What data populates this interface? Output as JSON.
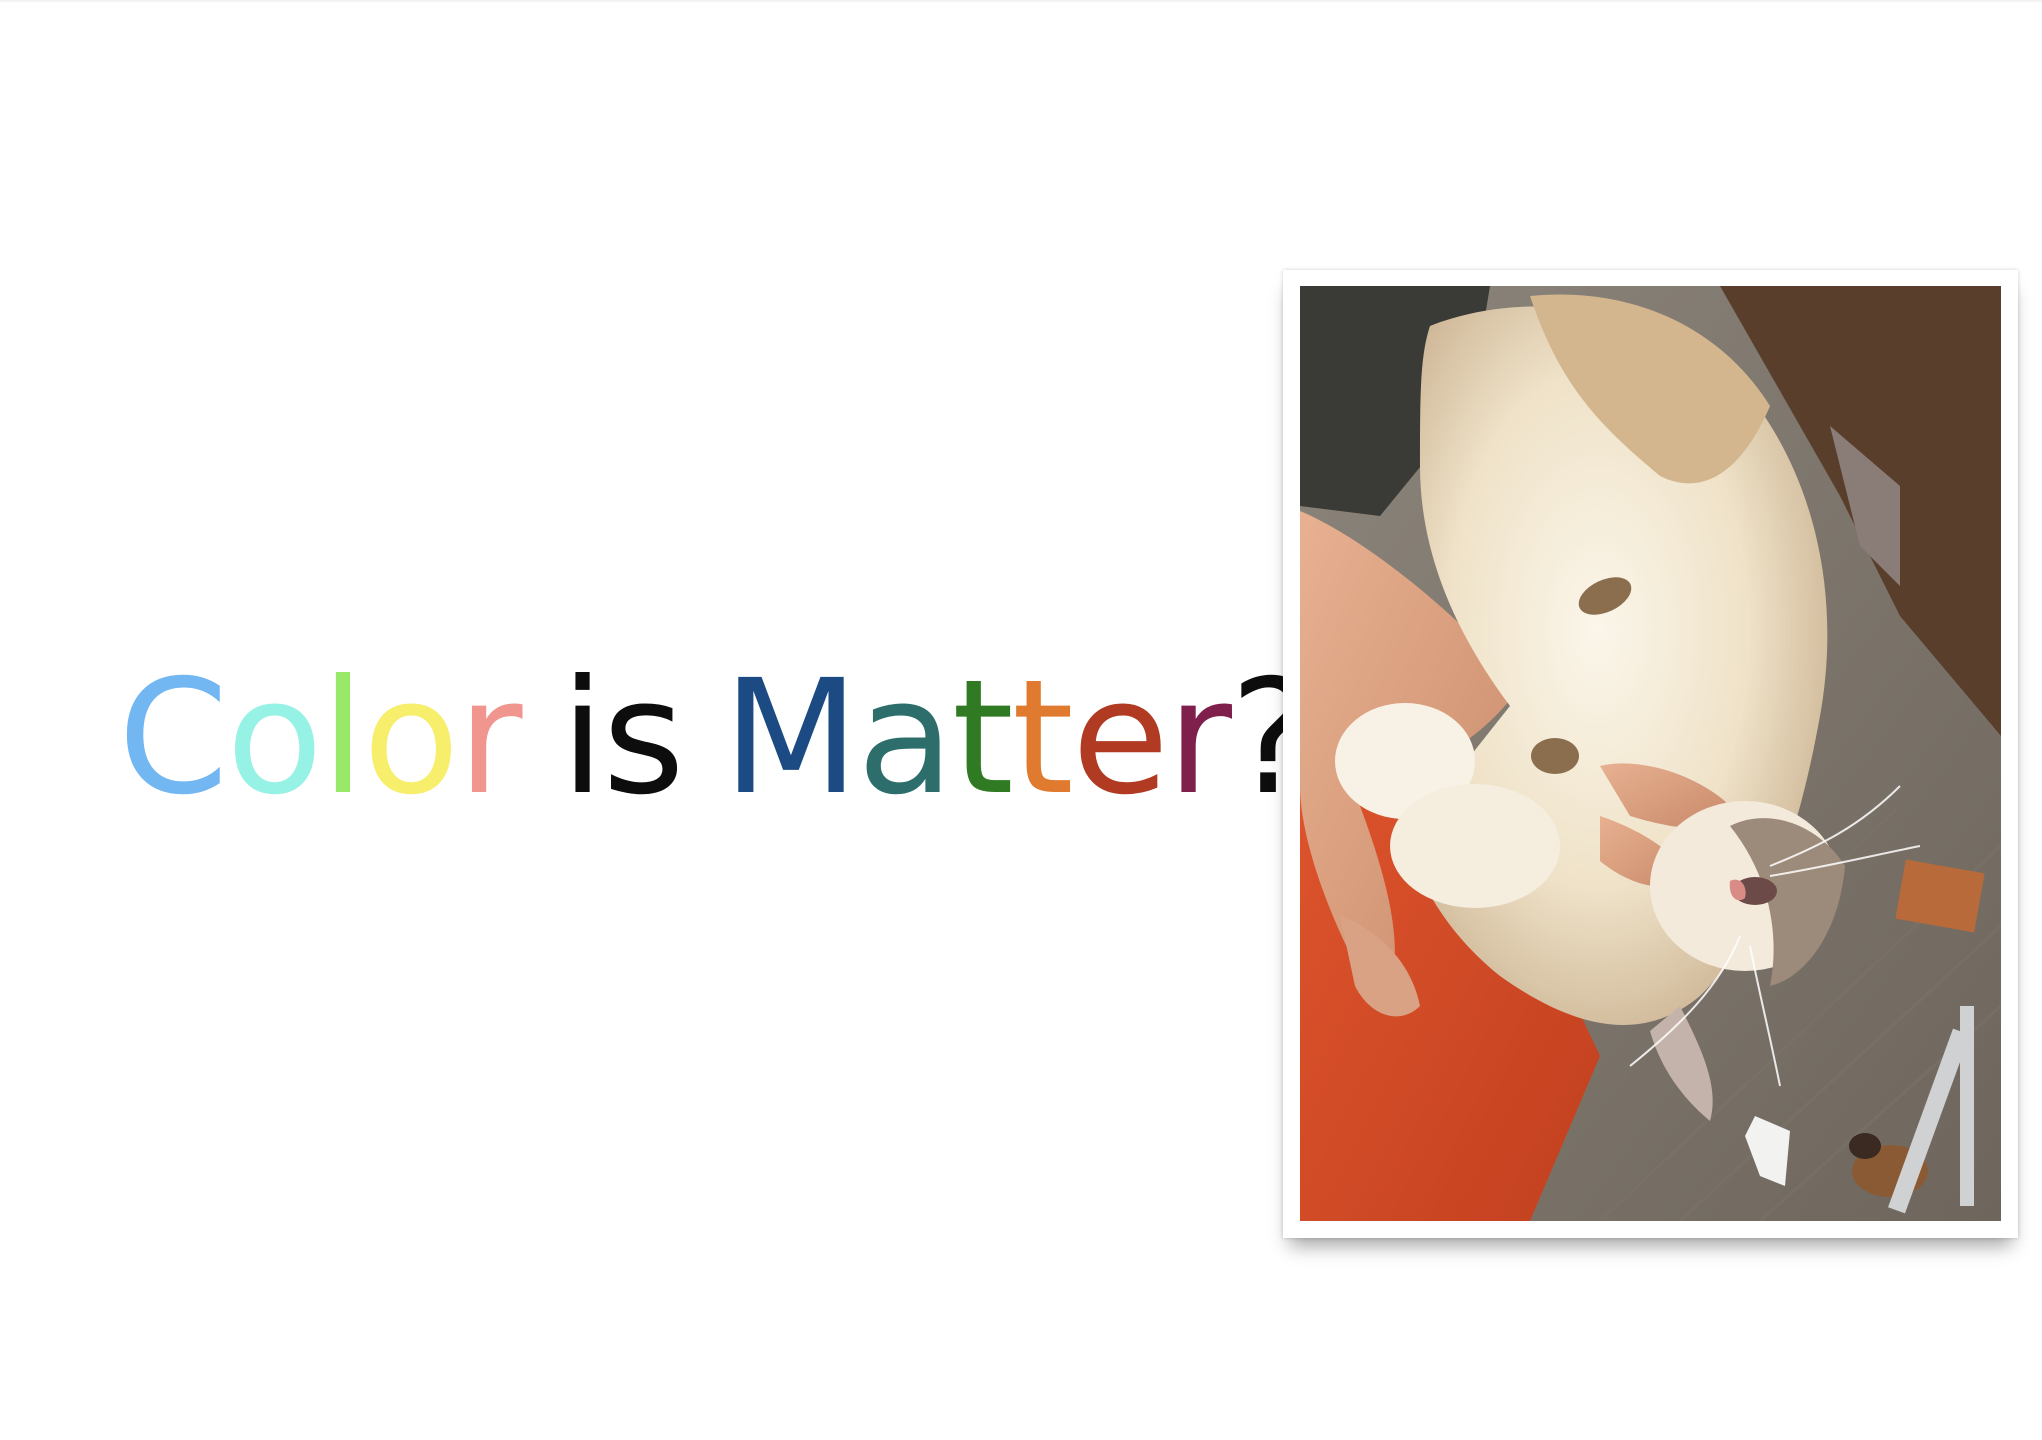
{
  "slide": {
    "title_letters": [
      {
        "char": "C",
        "color": "#72b6f2"
      },
      {
        "char": "o",
        "color": "#96f2e4"
      },
      {
        "char": "l",
        "color": "#98e86a"
      },
      {
        "char": "o",
        "color": "#f7ee6c"
      },
      {
        "char": "r",
        "color": "#f0968e"
      }
    ],
    "title_word2_letters": [
      {
        "char": "i",
        "color": "#0d0d0d"
      },
      {
        "char": "s",
        "color": "#0d0d0d"
      }
    ],
    "title_word3_letters": [
      {
        "char": "M",
        "color": "#1b4b82"
      },
      {
        "char": "a",
        "color": "#2d6e6c"
      },
      {
        "char": "t",
        "color": "#2f7a22"
      },
      {
        "char": "t",
        "color": "#e07a2e"
      },
      {
        "char": "e",
        "color": "#b03a22"
      },
      {
        "char": "r",
        "color": "#7e1f4c"
      },
      {
        "char": "?",
        "color": "#0d0d0d"
      }
    ],
    "photo": {
      "subject": "cat-photo"
    }
  }
}
